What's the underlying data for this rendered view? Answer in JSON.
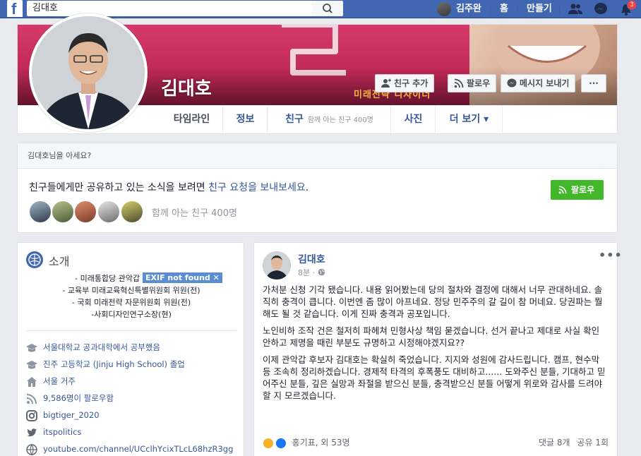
{
  "topbar": {
    "search_value": "김대호",
    "user_name": "김주완",
    "home": "홈",
    "create": "만들기",
    "notifications_count": "3"
  },
  "profile": {
    "name": "김대호",
    "cover_slogan": "미래전략 디자이너",
    "buttons": {
      "add_friend": "친구 추가",
      "follow": "팔로우",
      "message": "메시지 보내기",
      "more": "···"
    },
    "tabs": {
      "timeline": "타임라인",
      "about": "정보",
      "friends": "친구",
      "friends_sub": "함께 아는 친구 400명",
      "photos": "사진",
      "more": "더 보기 ▾"
    }
  },
  "know": {
    "heading": "김대호님을 아세요?",
    "text_before": "친구들에게만 공유하고 있는 소식을 보려면 ",
    "text_link": "친구 요청을 보내보세요",
    "text_after": ".",
    "follow_button": "팔로우",
    "mutual_text": "함께 아는 친구 400명"
  },
  "intro": {
    "title": "소개",
    "bio": [
      "- 미래통합당 관악갑 국회의원 후보",
      "- 교육부 미래교육혁신특별위원회 위원(전)",
      "- 국회 미래전략 자문위원회 위원(전)",
      "-사회디자인연구소장(현)"
    ],
    "items": [
      {
        "icon": "graduation-cap-icon",
        "text": "서울대학교 공과대학에서 공부했음"
      },
      {
        "icon": "graduation-cap-icon",
        "text": "진주 고등학교 (Jinju High School) 졸업"
      },
      {
        "icon": "home-icon",
        "text": "서울 거주"
      },
      {
        "icon": "follow-rss-icon",
        "text": "9,586명이 팔로우함"
      },
      {
        "icon": "instagram-icon",
        "text": "bigtiger_2020"
      },
      {
        "icon": "twitter-icon",
        "text": "itspolitics"
      },
      {
        "icon": "globe-icon",
        "text": "youtube.com/channel/UCclhYcixTLcL68hzR3gg"
      }
    ]
  },
  "exif_badge": "EXIF not found",
  "post": {
    "author": "김대호",
    "time": "8분 · ",
    "paragraphs": [
      "가처분 신청 기각 됐습니다. 내용 읽어봤는데 당의 절차와 결정에 대해서 너무 관대하네요. 솔직히 충격이 큽니다. 이번엔 좀 많이 아프네요. 정당 민주주의 갈 길이 참 머네요. 당권파는 뭘 해도 될 것 같습니다. 이게 진짜 충격과 공포입니다.",
      "노인비하 조작 건은 철저히 파헤쳐 민형사상 책임 묻겠습니다. 선거 끝나고 제대로 사실 확인 안하고 제명을 때린 부분도 규명하고 시정해야겠지요??",
      "이제 관악갑 후보자 김대호는 확실히 죽었습니다. 지지와 성원에 감사드립니다. 캠프, 현수막 등 조속히 정리하겠습니다. 경제적 타격의 후폭풍도 대비하고...... 도와주신 분들, 기대하고 믿어주신 분들, 깊은 실망과 좌절을 받으신 분들, 충격받으신 분들 어떻게 위로와 감사를 드려야 할 지 모르겠습니다."
    ],
    "reactions_text": "홍기표, 외 53명",
    "comments": "댓글 8개",
    "shares": "공유 1회"
  }
}
